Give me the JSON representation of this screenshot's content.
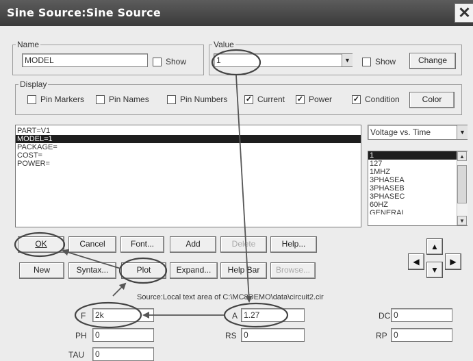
{
  "window": {
    "title": "Sine Source:Sine Source",
    "close_glyph": "✕"
  },
  "name_group": {
    "legend": "Name",
    "value": "MODEL",
    "show_label": "Show"
  },
  "value_group": {
    "legend": "Value",
    "value": "1",
    "show_label": "Show",
    "change_label": "Change"
  },
  "display_group": {
    "legend": "Display",
    "items": [
      {
        "label": "Pin Markers",
        "checked": false,
        "glyph": ""
      },
      {
        "label": "Pin Names",
        "checked": false,
        "glyph": ""
      },
      {
        "label": "Pin Numbers",
        "checked": false,
        "glyph": ""
      },
      {
        "label": "Current",
        "checked": true,
        "glyph": "✓"
      },
      {
        "label": "Power",
        "checked": true,
        "glyph": "✓"
      },
      {
        "label": "Condition",
        "checked": true,
        "glyph": "✓"
      }
    ],
    "color_label": "Color"
  },
  "attributes": [
    "PART=V1",
    "MODEL=1",
    "PACKAGE=",
    "COST=",
    "POWER="
  ],
  "plot_select": {
    "value": "Voltage vs. Time"
  },
  "model_list": [
    "1",
    "127",
    "1MHZ",
    "3PHASEA",
    "3PHASEB",
    "3PHASEC",
    "60HZ",
    "GENERAL"
  ],
  "buttons": {
    "ok": "OK",
    "cancel": "Cancel",
    "font": "Font...",
    "add": "Add",
    "delete": "Delete",
    "help": "Help...",
    "new": "New",
    "syntax": "Syntax...",
    "plot": "Plot",
    "expand": "Expand...",
    "help_bar": "Help Bar",
    "browse": "Browse..."
  },
  "nav_glyphs": {
    "up": "▲",
    "down": "▼",
    "left": "◀",
    "right": "▶"
  },
  "source_text": "Source:Local text area of C:\\MC8DEMO\\data\\circuit2.cir",
  "params": [
    {
      "label": "F",
      "value": "2k"
    },
    {
      "label": "A",
      "value": "1.27"
    },
    {
      "label": "DC",
      "value": "0"
    },
    {
      "label": "PH",
      "value": "0"
    },
    {
      "label": "RS",
      "value": "0"
    },
    {
      "label": "RP",
      "value": "0"
    },
    {
      "label": "TAU",
      "value": "0"
    }
  ]
}
